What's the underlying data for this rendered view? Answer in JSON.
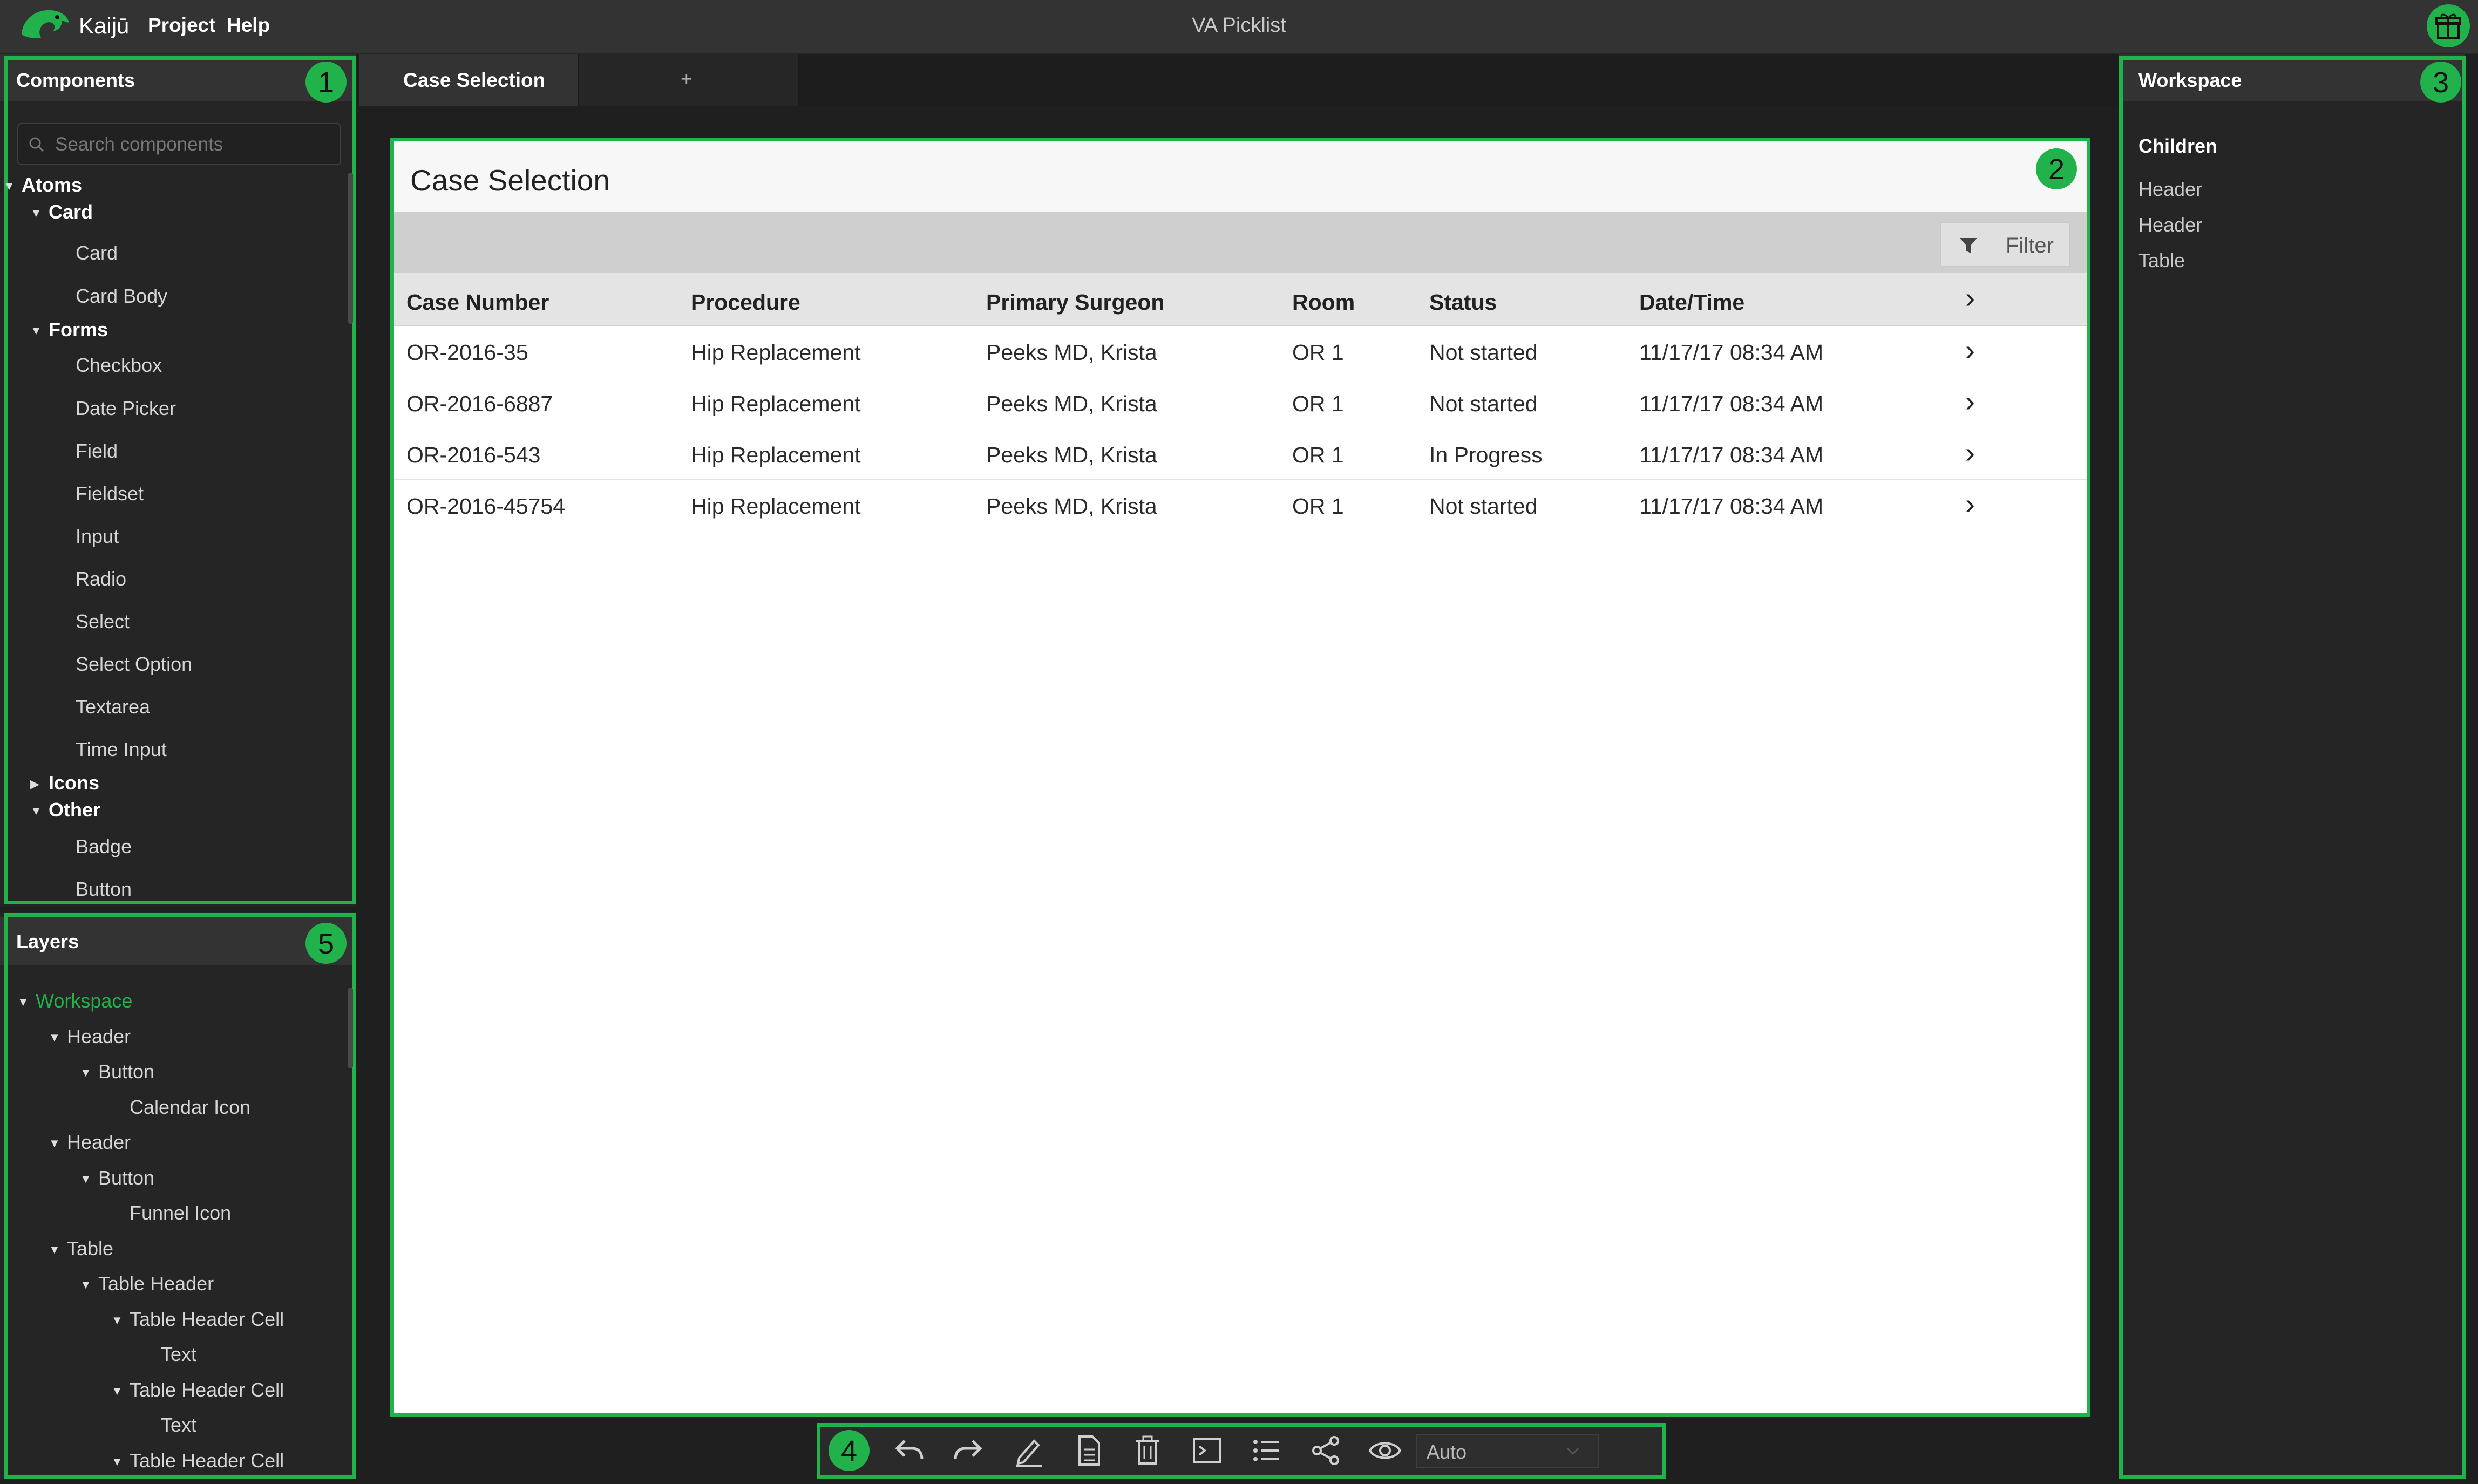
{
  "app": {
    "brand": "Kaijū",
    "menu": [
      "Project",
      "Help"
    ],
    "title": "VA Picklist"
  },
  "components_panel": {
    "title": "Components",
    "badge": "1",
    "search_placeholder": "Search components",
    "tree": [
      {
        "label": "Atoms",
        "level": 0,
        "expanded": true,
        "bold": true
      },
      {
        "label": "Card",
        "level": 1,
        "expanded": true,
        "bold": true
      },
      {
        "label": "Card",
        "level": 2
      },
      {
        "label": "Card Body",
        "level": 2
      },
      {
        "label": "Forms",
        "level": 1,
        "expanded": true,
        "bold": true
      },
      {
        "label": "Checkbox",
        "level": 2
      },
      {
        "label": "Date Picker",
        "level": 2
      },
      {
        "label": "Field",
        "level": 2
      },
      {
        "label": "Fieldset",
        "level": 2
      },
      {
        "label": "Input",
        "level": 2
      },
      {
        "label": "Radio",
        "level": 2
      },
      {
        "label": "Select",
        "level": 2
      },
      {
        "label": "Select Option",
        "level": 2
      },
      {
        "label": "Textarea",
        "level": 2
      },
      {
        "label": "Time Input",
        "level": 2
      },
      {
        "label": "Icons",
        "level": 1,
        "expanded": false,
        "bold": true
      },
      {
        "label": "Other",
        "level": 1,
        "expanded": true,
        "bold": true
      },
      {
        "label": "Badge",
        "level": 2
      },
      {
        "label": "Button",
        "level": 2
      }
    ]
  },
  "layers_panel": {
    "title": "Layers",
    "badge": "5",
    "tree": [
      {
        "label": "Workspace",
        "level": 0,
        "expanded": true,
        "active": true
      },
      {
        "label": "Header",
        "level": 1,
        "expanded": true
      },
      {
        "label": "Button",
        "level": 2,
        "expanded": true
      },
      {
        "label": "Calendar Icon",
        "level": 3
      },
      {
        "label": "Header",
        "level": 1,
        "expanded": true
      },
      {
        "label": "Button",
        "level": 2,
        "expanded": true
      },
      {
        "label": "Funnel Icon",
        "level": 3
      },
      {
        "label": "Table",
        "level": 1,
        "expanded": true
      },
      {
        "label": "Table Header",
        "level": 2,
        "expanded": true
      },
      {
        "label": "Table Header Cell",
        "level": 3,
        "expanded": true
      },
      {
        "label": "Text",
        "level": 4
      },
      {
        "label": "Table Header Cell",
        "level": 3,
        "expanded": true
      },
      {
        "label": "Text",
        "level": 4
      },
      {
        "label": "Table Header Cell",
        "level": 3,
        "expanded": true
      }
    ]
  },
  "tabs": [
    {
      "label": "Case Selection",
      "active": true
    },
    {
      "label": "+",
      "active": false
    }
  ],
  "canvas": {
    "badge": "2",
    "title": "Case Selection",
    "filter_label": "Filter",
    "columns": [
      "Case Number",
      "Procedure",
      "Primary Surgeon",
      "Room",
      "Status",
      "Date/Time"
    ],
    "rows": [
      [
        "OR-2016-35",
        "Hip Replacement",
        "Peeks MD, Krista",
        "OR 1",
        "Not started",
        "11/17/17 08:34 AM"
      ],
      [
        "OR-2016-6887",
        "Hip Replacement",
        "Peeks MD, Krista",
        "OR 1",
        "Not started",
        "11/17/17 08:34 AM"
      ],
      [
        "OR-2016-543",
        "Hip Replacement",
        "Peeks MD, Krista",
        "OR 1",
        "In Progress",
        "11/17/17 08:34 AM"
      ],
      [
        "OR-2016-45754",
        "Hip Replacement",
        "Peeks MD, Krista",
        "OR 1",
        "Not started",
        "11/17/17 08:34 AM"
      ]
    ]
  },
  "workspace_panel": {
    "title": "Workspace",
    "badge": "3",
    "children_heading": "Children",
    "children": [
      "Header",
      "Header",
      "Table"
    ]
  },
  "bottom_toolbar": {
    "badge": "4",
    "tools": [
      "undo-icon",
      "redo-icon",
      "pencil-icon",
      "document-icon",
      "trash-icon",
      "terminal-icon",
      "list-icon",
      "share-icon",
      "eye-icon"
    ],
    "zoom_value": "Auto"
  },
  "colors": {
    "accent_green": "#22b24c",
    "panel_bg": "#252525",
    "header_bg": "#333333"
  }
}
